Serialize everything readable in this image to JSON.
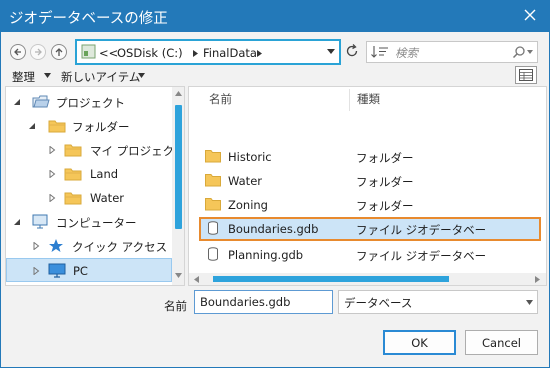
{
  "window": {
    "title": "ジオデータベースの修正"
  },
  "address_bar": {
    "overflow": "<<",
    "segments": [
      "OSDisk (C:)",
      "FinalData"
    ]
  },
  "search": {
    "placeholder": "検索"
  },
  "toolbar": {
    "organize_label": "整理",
    "new_item_label": "新しいアイテム"
  },
  "tree": {
    "items": [
      {
        "label": "プロジェクト",
        "icon": "project-icon",
        "state": "expanded"
      },
      {
        "label": "フォルダー",
        "icon": "folder-icon",
        "state": "expanded"
      },
      {
        "label": "マイ プロジェクト",
        "icon": "folder-icon",
        "state": "collapsed"
      },
      {
        "label": "Land",
        "icon": "folder-icon",
        "state": "collapsed"
      },
      {
        "label": "Water",
        "icon": "folder-icon",
        "state": "collapsed"
      },
      {
        "label": "コンピューター",
        "icon": "computer-icon",
        "state": "expanded"
      },
      {
        "label": "クイック アクセス",
        "icon": "star-icon",
        "state": "collapsed"
      },
      {
        "label": "PC",
        "icon": "monitor-icon",
        "state": "collapsed",
        "selected": true
      }
    ]
  },
  "file_list": {
    "columns": [
      "名前",
      "種類"
    ],
    "rows": [
      {
        "name": "Historic",
        "type": "フォルダー",
        "icon": "folder-icon"
      },
      {
        "name": "Water",
        "type": "フォルダー",
        "icon": "folder-icon"
      },
      {
        "name": "Zoning",
        "type": "フォルダー",
        "icon": "folder-icon"
      },
      {
        "name": "Boundaries.gdb",
        "type": "ファイル ジオデータベー",
        "icon": "geodatabase-icon",
        "selected": true
      },
      {
        "name": "Planning.gdb",
        "type": "ファイル ジオデータベー",
        "icon": "geodatabase-icon"
      }
    ]
  },
  "footer": {
    "name_label": "名前",
    "name_value": "Boundaries.gdb",
    "type_value": "データベース",
    "ok_label": "OK",
    "cancel_label": "Cancel"
  },
  "colors": {
    "title_bar": "#2379b9",
    "accent": "#2aa3d6",
    "selection": "#cce4f7",
    "highlight_border": "#e88a2e",
    "folder": "#f5c659"
  }
}
